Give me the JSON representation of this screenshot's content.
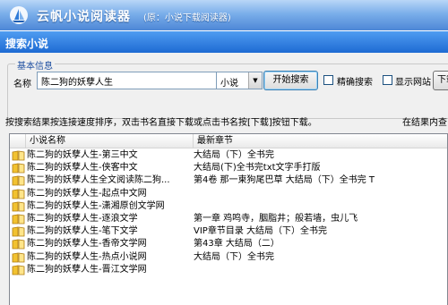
{
  "app": {
    "title": "云帆小说阅读器",
    "subtitle": "(原：小说下载阅读器)"
  },
  "window": {
    "title": "搜索小说"
  },
  "search": {
    "group_label": "基本信息",
    "name_label": "名称",
    "query": "陈二狗的妖孽人生",
    "type_selected": "小说",
    "search_button": "开始搜索",
    "exact_label": "精确搜索",
    "show_site_label": "显示网站",
    "download_button": "下载"
  },
  "hint": {
    "left": "按搜索结果按连接速度排序，双击书名直接下载或点击书名按[下载]按钮下载。",
    "right": "在结果内查"
  },
  "results": {
    "columns": [
      "小说名称",
      "最新章节"
    ],
    "rows": [
      {
        "name": "陈二狗的妖孽人生-第三中文",
        "chapter": "大结局（下）全书完"
      },
      {
        "name": "陈二狗的妖孽人生-侠客中文",
        "chapter": "大结局(下)全书完txt文字手打版"
      },
      {
        "name": "陈二狗的妖孽人生全文阅读陈二狗...",
        "chapter": "第4卷 那一柬狗尾巴草 大结局（下）全书完 T"
      },
      {
        "name": "陈二狗的妖孽人生-起点中文网",
        "chapter": ""
      },
      {
        "name": "陈二狗的妖孽人生-潇湘原创文学网",
        "chapter": ""
      },
      {
        "name": "陈二狗的妖孽人生-逐浪文学",
        "chapter": "第一章 鸡鸣寺，胭脂井；般若墙，虫儿飞"
      },
      {
        "name": "陈二狗的妖孽人生-笔下文学",
        "chapter": "VIP章节目录 大结局（下）全书完"
      },
      {
        "name": "陈二狗的妖孽人生-香帝文学网",
        "chapter": "第43章 大结局（二）"
      },
      {
        "name": "陈二狗的妖孽人生-热点小说网",
        "chapter": "大结局（下）全书完"
      },
      {
        "name": "陈二狗的妖孽人生-晋江文学网",
        "chapter": ""
      }
    ]
  },
  "colors": {
    "accent": "#1e6bd3",
    "title_gradient_top": "#b9d6f7",
    "book_icon": "#f2c230"
  },
  "icons": {
    "logo": "sail-logo-icon",
    "row": "book-icon",
    "dropdown": "chevron-down-icon"
  }
}
